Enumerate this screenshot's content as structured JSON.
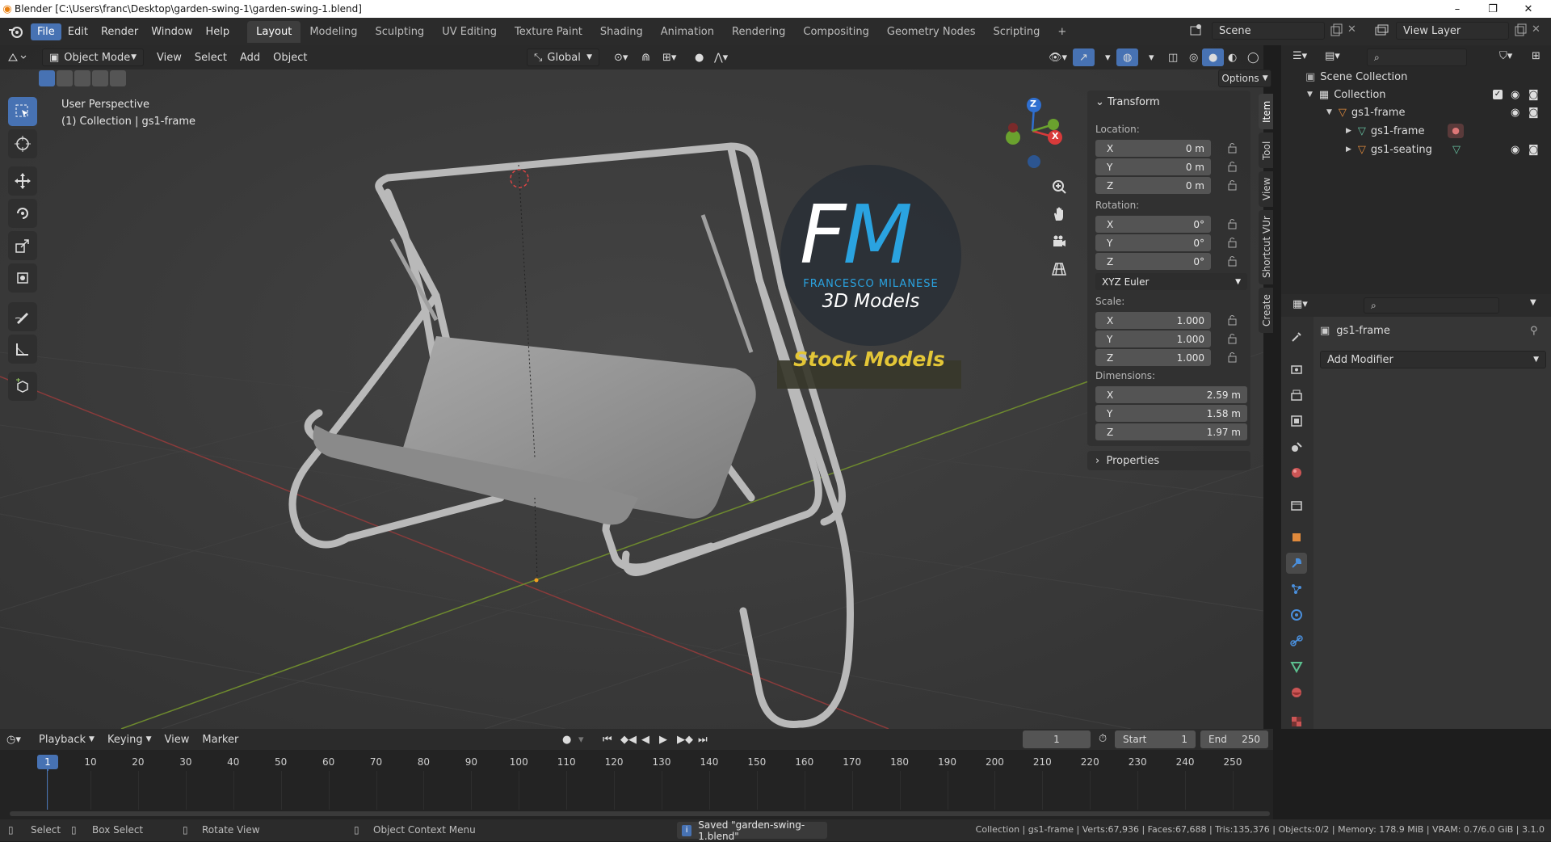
{
  "window": {
    "title": "Blender [C:\\Users\\franc\\Desktop\\garden-swing-1\\garden-swing-1.blend]",
    "minimize": "–",
    "maximize": "❐",
    "close": "✕"
  },
  "menu": [
    "File",
    "Edit",
    "Render",
    "Window",
    "Help"
  ],
  "workspaces": [
    "Layout",
    "Modeling",
    "Sculpting",
    "UV Editing",
    "Texture Paint",
    "Shading",
    "Animation",
    "Rendering",
    "Compositing",
    "Geometry Nodes",
    "Scripting"
  ],
  "add_workspace": "+",
  "scene": {
    "label": "Scene",
    "view_layer": "View Layer"
  },
  "viewport_header": {
    "mode": "Object Mode",
    "view": "View",
    "select": "Select",
    "add": "Add",
    "object": "Object",
    "orientation": "Global",
    "options": "Options"
  },
  "viewport": {
    "perspective": "User Perspective",
    "collection": "(1) Collection | gs1-frame"
  },
  "gizmo": {
    "z": "Z",
    "x": "X"
  },
  "watermark": {
    "letters": "FM",
    "author": "FRANCESCO MILANESE",
    "subtitle": "3D Models",
    "banner": "Stock Models"
  },
  "npanel": {
    "transform": "Transform",
    "location_label": "Location:",
    "location": [
      {
        "axis": "X",
        "value": "0 m"
      },
      {
        "axis": "Y",
        "value": "0 m"
      },
      {
        "axis": "Z",
        "value": "0 m"
      }
    ],
    "rotation_label": "Rotation:",
    "rotation": [
      {
        "axis": "X",
        "value": "0°"
      },
      {
        "axis": "Y",
        "value": "0°"
      },
      {
        "axis": "Z",
        "value": "0°"
      }
    ],
    "rotation_mode": "XYZ Euler",
    "scale_label": "Scale:",
    "scale": [
      {
        "axis": "X",
        "value": "1.000"
      },
      {
        "axis": "Y",
        "value": "1.000"
      },
      {
        "axis": "Z",
        "value": "1.000"
      }
    ],
    "dimensions_label": "Dimensions:",
    "dimensions": [
      {
        "axis": "X",
        "value": "2.59 m"
      },
      {
        "axis": "Y",
        "value": "1.58 m"
      },
      {
        "axis": "Z",
        "value": "1.97 m"
      }
    ],
    "properties": "Properties"
  },
  "sidetabs": [
    "Item",
    "Tool",
    "View",
    "Shortcut VUr",
    "Create"
  ],
  "outliner": {
    "scene_collection": "Scene Collection",
    "collection": "Collection",
    "items": [
      "gs1-frame",
      "gs1-frame",
      "gs1-seating"
    ]
  },
  "properties": {
    "object_name": "gs1-frame",
    "add_modifier": "Add Modifier"
  },
  "timeline": {
    "playback": "Playback",
    "keying": "Keying",
    "view": "View",
    "marker": "Marker",
    "current_frame": "1",
    "start_label": "Start",
    "start": "1",
    "end_label": "End",
    "end": "250",
    "ticks": [
      "1",
      "10",
      "20",
      "30",
      "40",
      "50",
      "60",
      "70",
      "80",
      "90",
      "100",
      "110",
      "120",
      "130",
      "140",
      "150",
      "160",
      "170",
      "180",
      "190",
      "200",
      "210",
      "220",
      "230",
      "240",
      "250"
    ]
  },
  "status": {
    "select": "Select",
    "box_select": "Box Select",
    "rotate_view": "Rotate View",
    "context_menu": "Object Context Menu",
    "message": "Saved \"garden-swing-1.blend\"",
    "stats": "Collection | gs1-frame | Verts:67,936 | Faces:67,688 | Tris:135,376 | Objects:0/2 | Memory: 178.9 MiB | VRAM: 0.7/6.0 GiB | 3.1.0"
  }
}
